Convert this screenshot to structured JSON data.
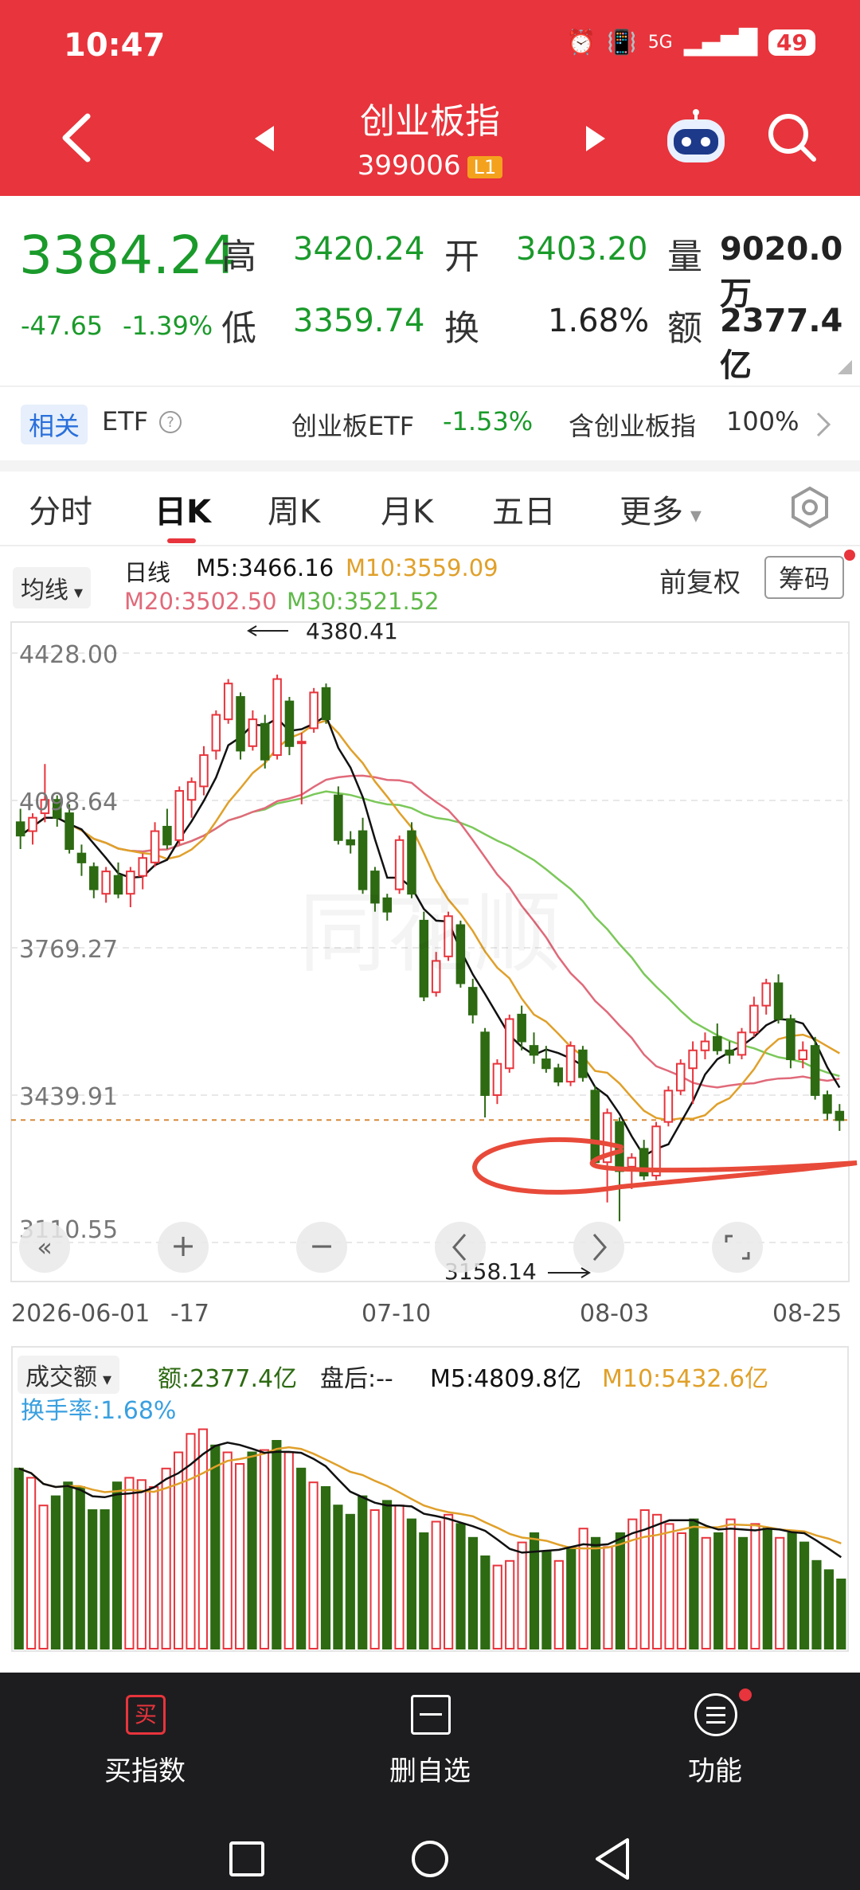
{
  "status_bar": {
    "time": "10:47",
    "signal": "5G",
    "battery": "49"
  },
  "header": {
    "title": "创业板指",
    "code": "399006",
    "level_badge": "L1",
    "icons": [
      "back-arrow-icon",
      "prev-triangle-icon",
      "next-triangle-icon",
      "robot-assistant-icon",
      "search-icon"
    ]
  },
  "quote": {
    "price": "3384.24",
    "change": "-47.65",
    "change_pct": "-1.39%",
    "high_label": "高",
    "high": "3420.24",
    "open_label": "开",
    "open": "3403.20",
    "volume_label": "量",
    "volume": "9020.0万",
    "low_label": "低",
    "low": "3359.74",
    "turnover_label": "换",
    "turnover": "1.68%",
    "amount_label": "额",
    "amount": "2377.4亿"
  },
  "related": {
    "tag": "相关",
    "etf_label": "ETF",
    "etf_name": "创业板ETF",
    "etf_change": "-1.53%",
    "holding_label": "含创业板指",
    "holding_pct": "100%"
  },
  "tabs": [
    {
      "label": "分时"
    },
    {
      "label": "日K"
    },
    {
      "label": "周K"
    },
    {
      "label": "月K"
    },
    {
      "label": "五日"
    },
    {
      "label": "更多"
    }
  ],
  "chart_controls": {
    "ma_dropdown": "均线",
    "adjust": "前复权",
    "chips_button": "筹码"
  },
  "ma_legend": {
    "daily": "日线",
    "m5": "M5:3466.16",
    "m10": "M10:3559.09",
    "m20": "M20:3502.50",
    "m30": "M30:3521.52"
  },
  "volume_panel": {
    "dropdown": "成交额",
    "amount": "额:2377.4亿",
    "after_hours": "盘后:--",
    "m5": "M5:4809.8亿",
    "m10": "M10:5432.6亿",
    "turnover": "换手率:1.68%"
  },
  "bottom_nav": [
    {
      "label": "买指数",
      "icon_char": "买"
    },
    {
      "label": "删自选"
    },
    {
      "label": "功能"
    }
  ],
  "colors": {
    "header": "#e8343c",
    "up": "#e8343c",
    "down": "#2d6a12",
    "ma5": "#111111",
    "ma10": "#e0a02a",
    "ma20": "#e06a7a",
    "ma30": "#7cc85a"
  },
  "chart_data": {
    "type": "candlestick",
    "y_ticks": [
      "4428.00",
      "4098.64",
      "3769.27",
      "3439.91",
      "3110.55"
    ],
    "ylim": [
      3110.55,
      4428.0
    ],
    "x_labels": [
      "2026-06-01",
      "-17",
      "07-10",
      "08-03",
      "08-25"
    ],
    "annotations": {
      "high": "4380.41",
      "low": "3158.14"
    },
    "candles": [
      {
        "o": 4050,
        "h": 4080,
        "l": 3990,
        "c": 4020
      },
      {
        "o": 4030,
        "h": 4070,
        "l": 4000,
        "c": 4060
      },
      {
        "o": 4070,
        "h": 4180,
        "l": 4050,
        "c": 4100
      },
      {
        "o": 4100,
        "h": 4110,
        "l": 4040,
        "c": 4060
      },
      {
        "o": 4070,
        "h": 4090,
        "l": 3980,
        "c": 3990
      },
      {
        "o": 3980,
        "h": 4000,
        "l": 3930,
        "c": 3960
      },
      {
        "o": 3950,
        "h": 3960,
        "l": 3880,
        "c": 3900
      },
      {
        "o": 3890,
        "h": 3950,
        "l": 3870,
        "c": 3940
      },
      {
        "o": 3930,
        "h": 3960,
        "l": 3880,
        "c": 3890
      },
      {
        "o": 3890,
        "h": 3950,
        "l": 3860,
        "c": 3940
      },
      {
        "o": 3930,
        "h": 3980,
        "l": 3900,
        "c": 3970
      },
      {
        "o": 3960,
        "h": 4050,
        "l": 3950,
        "c": 4030
      },
      {
        "o": 4040,
        "h": 4080,
        "l": 3990,
        "c": 4000
      },
      {
        "o": 4010,
        "h": 4130,
        "l": 4000,
        "c": 4120
      },
      {
        "o": 4100,
        "h": 4150,
        "l": 4060,
        "c": 4140
      },
      {
        "o": 4130,
        "h": 4220,
        "l": 4110,
        "c": 4200
      },
      {
        "o": 4210,
        "h": 4300,
        "l": 4190,
        "c": 4290
      },
      {
        "o": 4280,
        "h": 4370,
        "l": 4270,
        "c": 4360
      },
      {
        "o": 4330,
        "h": 4340,
        "l": 4190,
        "c": 4210
      },
      {
        "o": 4220,
        "h": 4300,
        "l": 4210,
        "c": 4280
      },
      {
        "o": 4270,
        "h": 4290,
        "l": 4170,
        "c": 4190
      },
      {
        "o": 4200,
        "h": 4380,
        "l": 4190,
        "c": 4370
      },
      {
        "o": 4320,
        "h": 4330,
        "l": 4200,
        "c": 4220
      },
      {
        "o": 4230,
        "h": 4250,
        "l": 4090,
        "c": 4230
      },
      {
        "o": 4260,
        "h": 4350,
        "l": 4250,
        "c": 4340
      },
      {
        "o": 4350,
        "h": 4360,
        "l": 4270,
        "c": 4280
      },
      {
        "o": 4110,
        "h": 4130,
        "l": 4000,
        "c": 4010
      },
      {
        "o": 4010,
        "h": 4030,
        "l": 3980,
        "c": 4000
      },
      {
        "o": 4030,
        "h": 4060,
        "l": 3890,
        "c": 3900
      },
      {
        "o": 3940,
        "h": 3950,
        "l": 3850,
        "c": 3870
      },
      {
        "o": 3880,
        "h": 3890,
        "l": 3830,
        "c": 3850
      },
      {
        "o": 3900,
        "h": 4020,
        "l": 3890,
        "c": 4010
      },
      {
        "o": 4030,
        "h": 4050,
        "l": 3880,
        "c": 3890
      },
      {
        "o": 3830,
        "h": 3850,
        "l": 3650,
        "c": 3660
      },
      {
        "o": 3670,
        "h": 3760,
        "l": 3660,
        "c": 3740
      },
      {
        "o": 3750,
        "h": 3850,
        "l": 3740,
        "c": 3840
      },
      {
        "o": 3820,
        "h": 3830,
        "l": 3680,
        "c": 3690
      },
      {
        "o": 3680,
        "h": 3700,
        "l": 3600,
        "c": 3620
      },
      {
        "o": 3580,
        "h": 3590,
        "l": 3390,
        "c": 3440
      },
      {
        "o": 3440,
        "h": 3520,
        "l": 3420,
        "c": 3510
      },
      {
        "o": 3500,
        "h": 3620,
        "l": 3490,
        "c": 3610
      },
      {
        "o": 3620,
        "h": 3640,
        "l": 3540,
        "c": 3560
      },
      {
        "o": 3550,
        "h": 3580,
        "l": 3510,
        "c": 3530
      },
      {
        "o": 3520,
        "h": 3550,
        "l": 3490,
        "c": 3500
      },
      {
        "o": 3500,
        "h": 3510,
        "l": 3460,
        "c": 3470
      },
      {
        "o": 3470,
        "h": 3560,
        "l": 3460,
        "c": 3550
      },
      {
        "o": 3540,
        "h": 3550,
        "l": 3470,
        "c": 3480
      },
      {
        "o": 3450,
        "h": 3460,
        "l": 3280,
        "c": 3290
      },
      {
        "o": 3290,
        "h": 3410,
        "l": 3200,
        "c": 3400
      },
      {
        "o": 3380,
        "h": 3390,
        "l": 3158,
        "c": 3270
      },
      {
        "o": 3280,
        "h": 3310,
        "l": 3230,
        "c": 3300
      },
      {
        "o": 3320,
        "h": 3340,
        "l": 3250,
        "c": 3260
      },
      {
        "o": 3260,
        "h": 3380,
        "l": 3250,
        "c": 3370
      },
      {
        "o": 3380,
        "h": 3460,
        "l": 3370,
        "c": 3450
      },
      {
        "o": 3450,
        "h": 3520,
        "l": 3440,
        "c": 3510
      },
      {
        "o": 3500,
        "h": 3560,
        "l": 3420,
        "c": 3540
      },
      {
        "o": 3540,
        "h": 3580,
        "l": 3520,
        "c": 3560
      },
      {
        "o": 3570,
        "h": 3600,
        "l": 3530,
        "c": 3540
      },
      {
        "o": 3540,
        "h": 3560,
        "l": 3510,
        "c": 3530
      },
      {
        "o": 3530,
        "h": 3590,
        "l": 3520,
        "c": 3580
      },
      {
        "o": 3580,
        "h": 3660,
        "l": 3570,
        "c": 3640
      },
      {
        "o": 3640,
        "h": 3700,
        "l": 3620,
        "c": 3690
      },
      {
        "o": 3690,
        "h": 3710,
        "l": 3600,
        "c": 3610
      },
      {
        "o": 3610,
        "h": 3620,
        "l": 3500,
        "c": 3520
      },
      {
        "o": 3520,
        "h": 3560,
        "l": 3500,
        "c": 3540
      },
      {
        "o": 3550,
        "h": 3570,
        "l": 3430,
        "c": 3440
      },
      {
        "o": 3440,
        "h": 3450,
        "l": 3385,
        "c": 3400
      },
      {
        "o": 3403,
        "h": 3420,
        "l": 3360,
        "c": 3384
      }
    ],
    "volume_bars": [
      {
        "v": 0.78,
        "up": false
      },
      {
        "v": 0.74,
        "up": true
      },
      {
        "v": 0.62,
        "up": true
      },
      {
        "v": 0.66,
        "up": false
      },
      {
        "v": 0.72,
        "up": false
      },
      {
        "v": 0.7,
        "up": false
      },
      {
        "v": 0.6,
        "up": false
      },
      {
        "v": 0.6,
        "up": false
      },
      {
        "v": 0.72,
        "up": false
      },
      {
        "v": 0.74,
        "up": true
      },
      {
        "v": 0.73,
        "up": true
      },
      {
        "v": 0.7,
        "up": true
      },
      {
        "v": 0.78,
        "up": true
      },
      {
        "v": 0.85,
        "up": true
      },
      {
        "v": 0.93,
        "up": true
      },
      {
        "v": 0.95,
        "up": true
      },
      {
        "v": 0.88,
        "up": false
      },
      {
        "v": 0.85,
        "up": true
      },
      {
        "v": 0.8,
        "up": true
      },
      {
        "v": 0.85,
        "up": false
      },
      {
        "v": 0.86,
        "up": true
      },
      {
        "v": 0.9,
        "up": false
      },
      {
        "v": 0.85,
        "up": true
      },
      {
        "v": 0.78,
        "up": false
      },
      {
        "v": 0.72,
        "up": true
      },
      {
        "v": 0.7,
        "up": false
      },
      {
        "v": 0.62,
        "up": false
      },
      {
        "v": 0.58,
        "up": false
      },
      {
        "v": 0.66,
        "up": false
      },
      {
        "v": 0.6,
        "up": true
      },
      {
        "v": 0.64,
        "up": false
      },
      {
        "v": 0.62,
        "up": true
      },
      {
        "v": 0.56,
        "up": false
      },
      {
        "v": 0.5,
        "up": false
      },
      {
        "v": 0.55,
        "up": true
      },
      {
        "v": 0.58,
        "up": true
      },
      {
        "v": 0.54,
        "up": false
      },
      {
        "v": 0.48,
        "up": false
      },
      {
        "v": 0.4,
        "up": false
      },
      {
        "v": 0.36,
        "up": true
      },
      {
        "v": 0.38,
        "up": true
      },
      {
        "v": 0.46,
        "up": true
      },
      {
        "v": 0.5,
        "up": false
      },
      {
        "v": 0.42,
        "up": false
      },
      {
        "v": 0.38,
        "up": true
      },
      {
        "v": 0.44,
        "up": false
      },
      {
        "v": 0.52,
        "up": true
      },
      {
        "v": 0.48,
        "up": false
      },
      {
        "v": 0.44,
        "up": true
      },
      {
        "v": 0.5,
        "up": false
      },
      {
        "v": 0.56,
        "up": true
      },
      {
        "v": 0.6,
        "up": true
      },
      {
        "v": 0.58,
        "up": true
      },
      {
        "v": 0.54,
        "up": true
      },
      {
        "v": 0.5,
        "up": true
      },
      {
        "v": 0.56,
        "up": false
      },
      {
        "v": 0.48,
        "up": true
      },
      {
        "v": 0.5,
        "up": false
      },
      {
        "v": 0.56,
        "up": true
      },
      {
        "v": 0.48,
        "up": false
      },
      {
        "v": 0.54,
        "up": true
      },
      {
        "v": 0.52,
        "up": false
      },
      {
        "v": 0.48,
        "up": true
      },
      {
        "v": 0.5,
        "up": false
      },
      {
        "v": 0.46,
        "up": false
      },
      {
        "v": 0.38,
        "up": false
      },
      {
        "v": 0.34,
        "up": false
      },
      {
        "v": 0.3,
        "up": false
      }
    ]
  }
}
